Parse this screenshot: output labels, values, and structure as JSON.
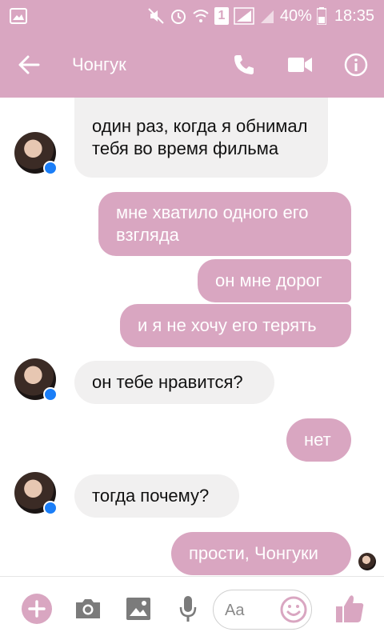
{
  "status_bar": {
    "sim_label": "1",
    "battery_percent": "40%",
    "time": "18:35"
  },
  "header": {
    "contact_name": "Чонгук",
    "back_icon": "arrow-left-icon",
    "call_icon": "phone-icon",
    "video_icon": "video-camera-icon",
    "info_icon": "info-icon"
  },
  "messages": [
    {
      "direction": "incoming",
      "text": "один раз, когда я обнимал тебя во время фильма"
    },
    {
      "direction": "outgoing",
      "text": "мне хватило одного его взгляда"
    },
    {
      "direction": "outgoing",
      "text": "он мне дорог"
    },
    {
      "direction": "outgoing",
      "text": "и я не хочу его терять"
    },
    {
      "direction": "incoming",
      "text": "он тебе нравится?"
    },
    {
      "direction": "outgoing",
      "text": "нет"
    },
    {
      "direction": "incoming",
      "text": "тогда почему?"
    },
    {
      "direction": "outgoing",
      "text": "прости, Чонгуки"
    }
  ],
  "composer": {
    "placeholder": "Aa",
    "icons": [
      "plus-icon",
      "camera-icon",
      "image-icon",
      "microphone-icon",
      "emoji-icon",
      "thumbs-up-icon"
    ]
  },
  "colors": {
    "accent": "#d9a6c1",
    "incoming_bubble": "#f1f0f0",
    "messenger_badge": "#1b7ef7"
  }
}
